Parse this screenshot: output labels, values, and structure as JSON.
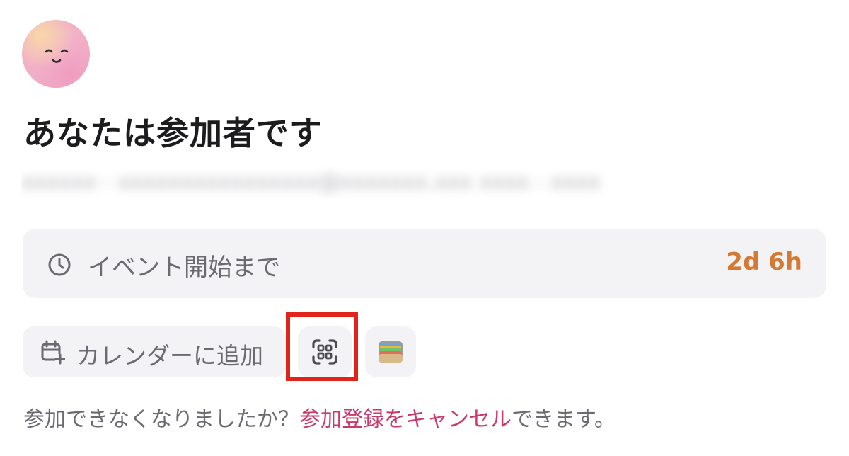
{
  "header": {
    "title": "あなたは参加者です",
    "email_blurred": "xxxxxx - xxxxxxxxxxxxxxxx@xxxxxxx.xxx xxxx - xxxx"
  },
  "countdown": {
    "label": "イベント開始まで",
    "value": "2d 6h",
    "value_color": "#d57a35",
    "icon": "clock-icon"
  },
  "actions": {
    "calendar_label": "カレンダーに追加",
    "calendar_icon": "calendar-add-icon",
    "qr_icon": "qr-code-icon",
    "wallet_icon": "wallet-icon"
  },
  "footer": {
    "prefix": "参加できなくなりましたか？",
    "cancel_link": "参加登録をキャンセル",
    "suffix": "できます。",
    "link_color": "#c93a6a"
  },
  "highlight": {
    "color": "#e2231a",
    "target": "qr-code-button"
  }
}
